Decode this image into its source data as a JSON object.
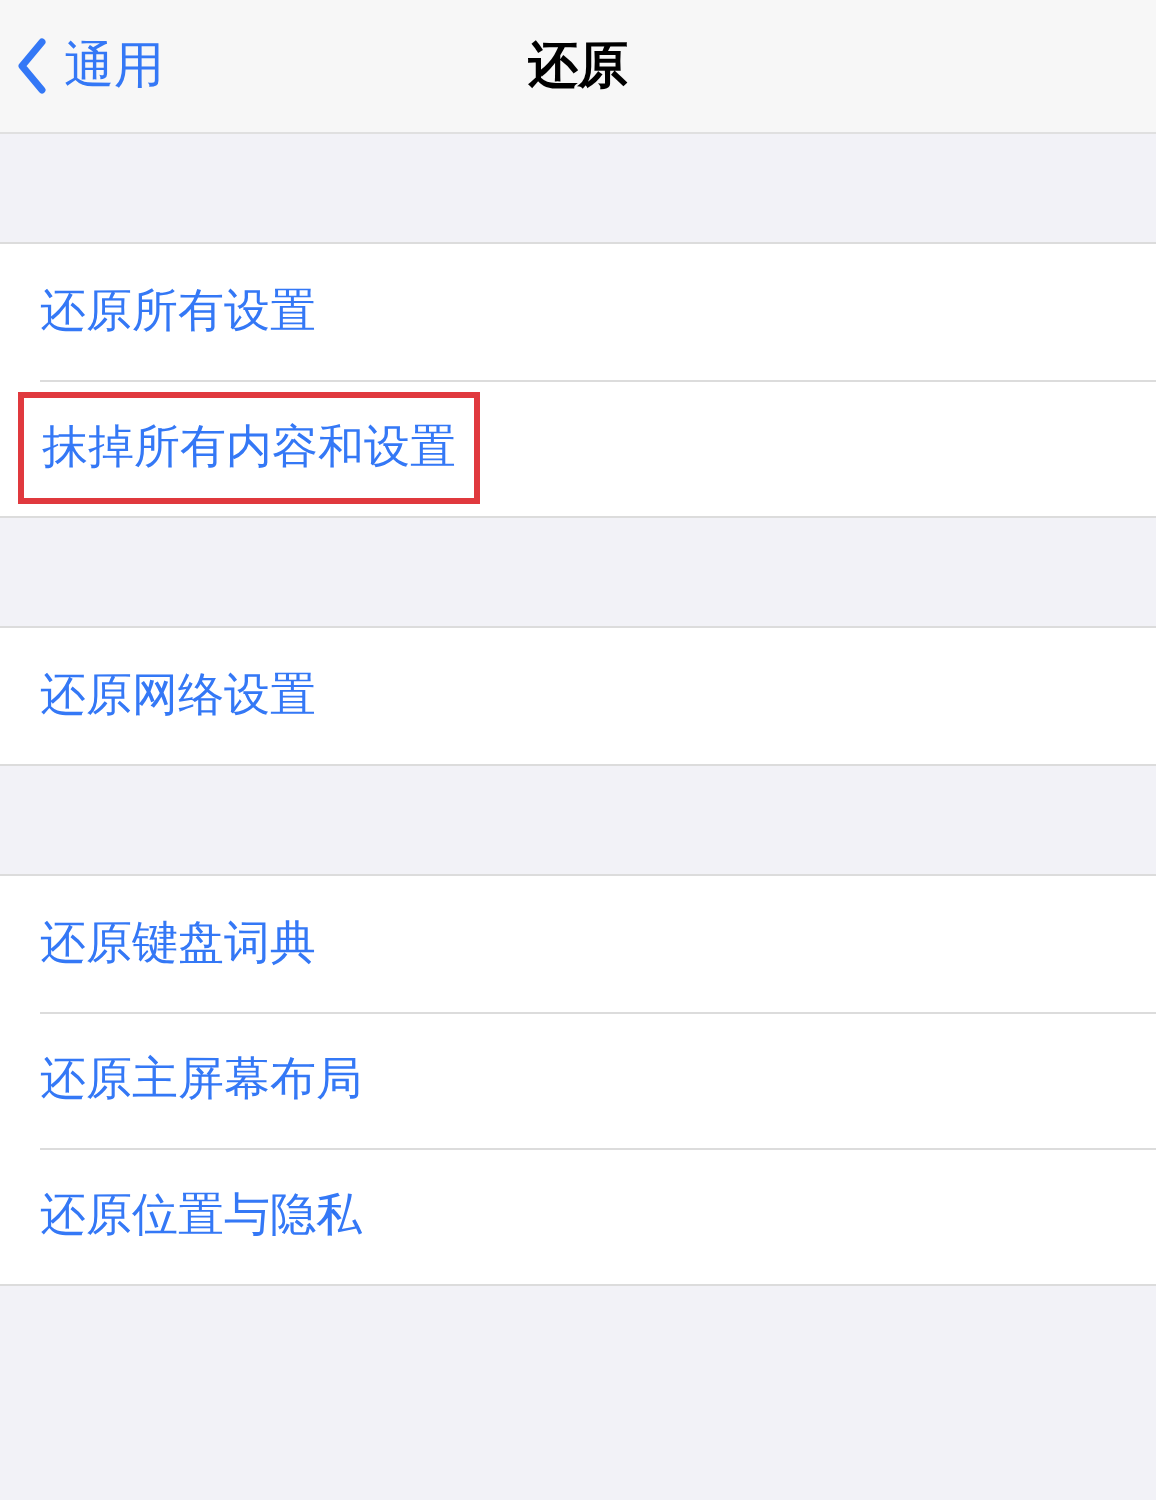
{
  "nav_bar": {
    "back_label": "通用",
    "title": "还原"
  },
  "groups": [
    {
      "items": [
        {
          "label": "还原所有设置",
          "highlighted": false
        },
        {
          "label": "抹掉所有内容和设置",
          "highlighted": true
        }
      ]
    },
    {
      "items": [
        {
          "label": "还原网络设置",
          "highlighted": false
        }
      ]
    },
    {
      "items": [
        {
          "label": "还原键盘词典",
          "highlighted": false
        },
        {
          "label": "还原主屏幕布局",
          "highlighted": false
        },
        {
          "label": "还原位置与隐私",
          "highlighted": false
        }
      ]
    }
  ]
}
